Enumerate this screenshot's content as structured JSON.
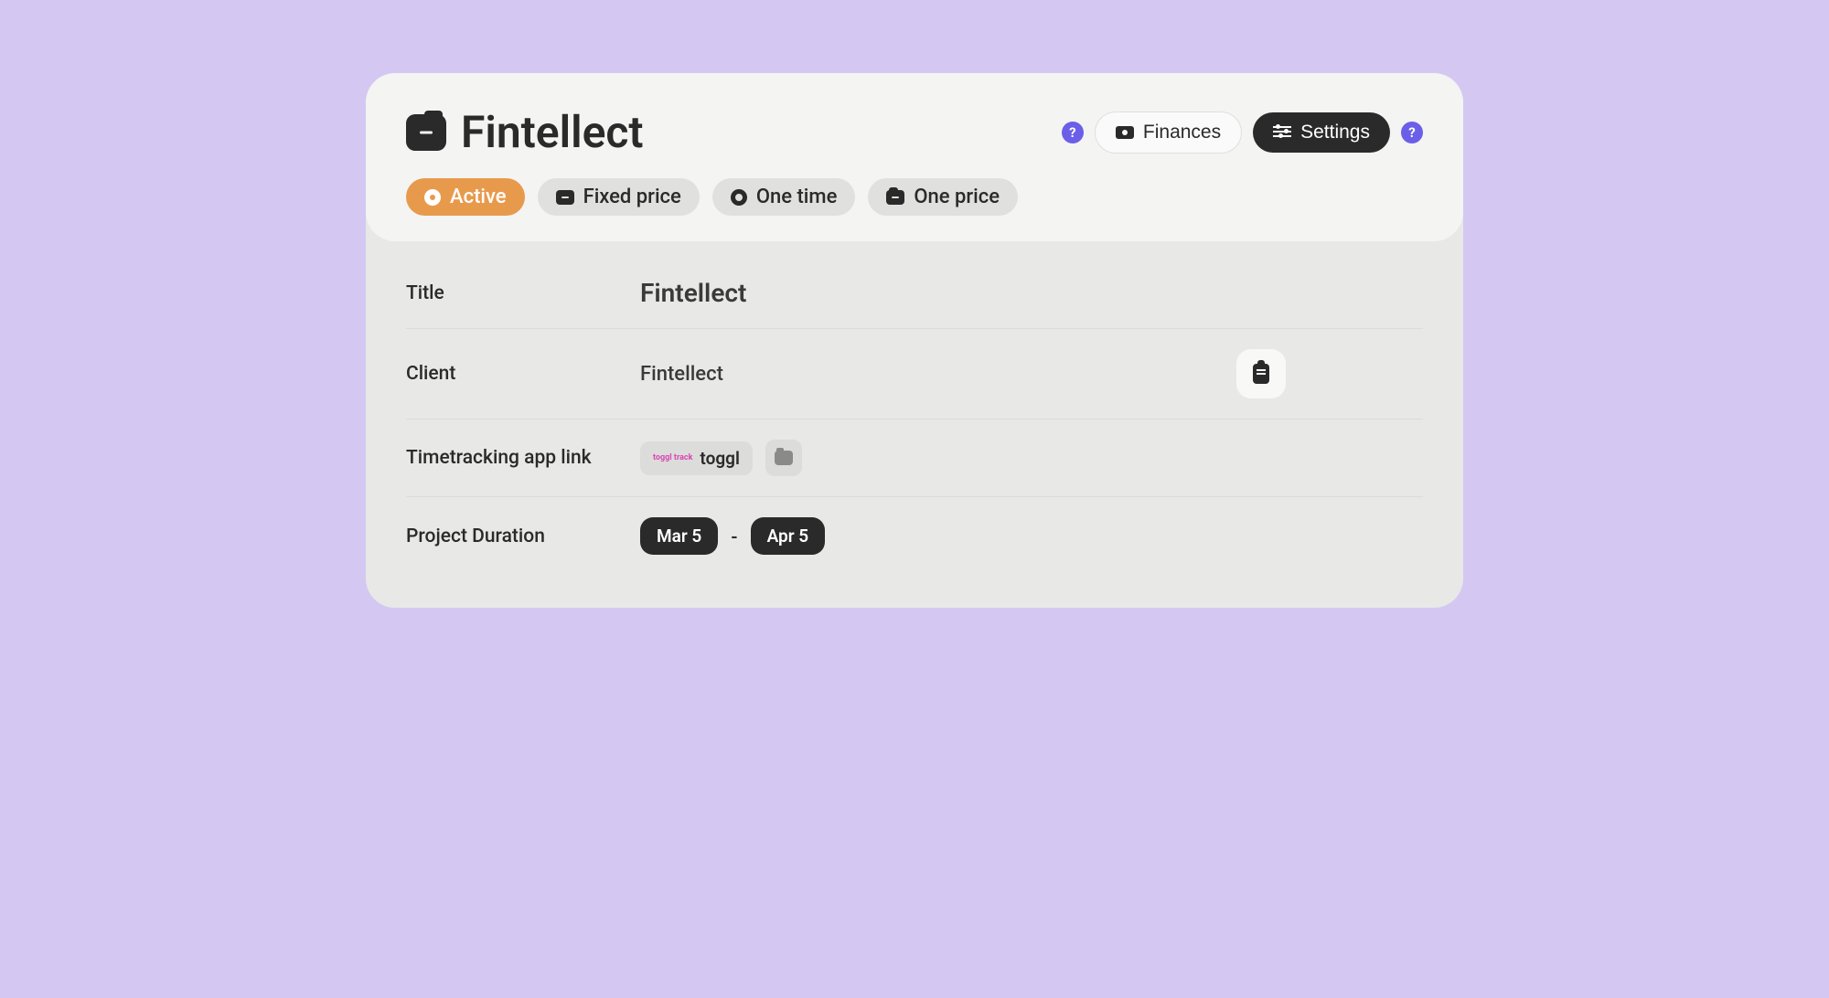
{
  "header": {
    "title": "Fintellect",
    "actions": {
      "finances_label": "Finances",
      "settings_label": "Settings"
    }
  },
  "tags": [
    {
      "label": "Active",
      "active": true,
      "icon": "dot"
    },
    {
      "label": "Fixed price",
      "active": false,
      "icon": "folder"
    },
    {
      "label": "One time",
      "active": false,
      "icon": "circle"
    },
    {
      "label": "One price",
      "active": false,
      "icon": "wallet"
    }
  ],
  "fields": {
    "title": {
      "label": "Title",
      "value": "Fintellect"
    },
    "client": {
      "label": "Client",
      "value": "Fintellect"
    },
    "timetracking": {
      "label": "Timetracking app link",
      "app_name": "toggl",
      "badge": "toggl track"
    },
    "duration": {
      "label": "Project Duration",
      "start": "Mar 5",
      "end": "Apr 5",
      "separator": "-"
    }
  }
}
